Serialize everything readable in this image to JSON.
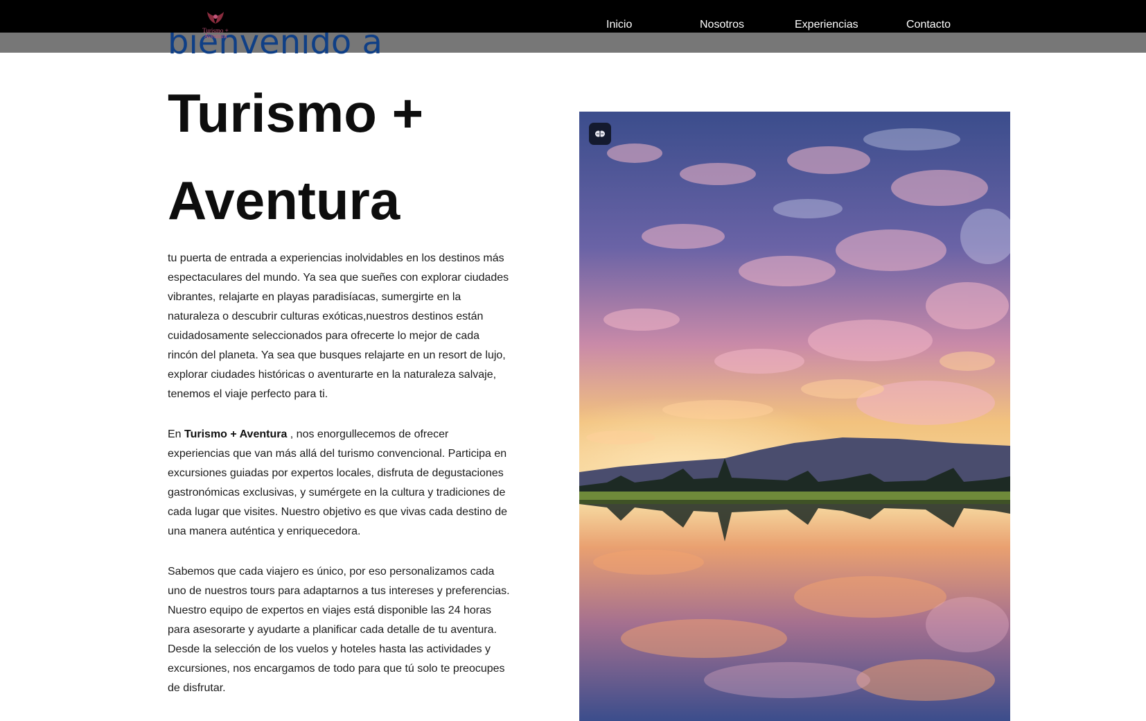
{
  "header": {
    "logo_text_line1": "Turismo +",
    "logo_text_line2": "Aventura",
    "nav": [
      {
        "label": "Inicio"
      },
      {
        "label": "Nosotros"
      },
      {
        "label": "Experiencias"
      },
      {
        "label": "Contacto"
      }
    ]
  },
  "hero": {
    "welcome": "bienvenido a",
    "title_line1": "Turismo +",
    "title_line2": "Aventura"
  },
  "content": {
    "paragraph1": "tu puerta de entrada a experiencias inolvidables en los destinos más espectaculares del mundo. Ya sea que sueñes con explorar ciudades vibrantes, relajarte en playas paradisíacas, sumergirte en la naturaleza o descubrir culturas exóticas,nuestros destinos están cuidadosamente seleccionados para ofrecerte lo mejor de cada rincón del planeta. Ya sea que busques relajarte en un resort de lujo, explorar ciudades históricas o aventurarte en la naturaleza salvaje, tenemos el viaje perfecto para ti.",
    "paragraph2_prefix": "En ",
    "paragraph2_brand": "Turismo + Aventura",
    "paragraph2_rest": " , nos enorgullecemos de ofrecer experiencias que van más allá del turismo convencional. Participa en excursiones guiadas por expertos locales, disfruta de degustaciones gastronómicas exclusivas, y sumérgete en la cultura y tradiciones de cada lugar que visites. Nuestro objetivo es que vivas cada destino de una manera auténtica y enriquecedora.",
    "paragraph3": "Sabemos que cada viajero es único, por eso personalizamos cada uno de nuestros tours para adaptarnos a tus intereses y preferencias. Nuestro equipo de expertos en viajes está disponible las 24 horas para asesorarte y ayudarte a planificar cada detalle de tu aventura. Desde la selección de los vuelos y hoteles hasta las actividades y excursiones, nos encargamos de todo para que tú solo te preocupes de disfrutar."
  },
  "photo": {
    "badge_icon": "brain-icon"
  },
  "colors": {
    "topbar": "#000000",
    "greybar": "#777777",
    "welcome": "#0f3f86",
    "title": "#0d0d0d",
    "logo": "#c2557a"
  }
}
